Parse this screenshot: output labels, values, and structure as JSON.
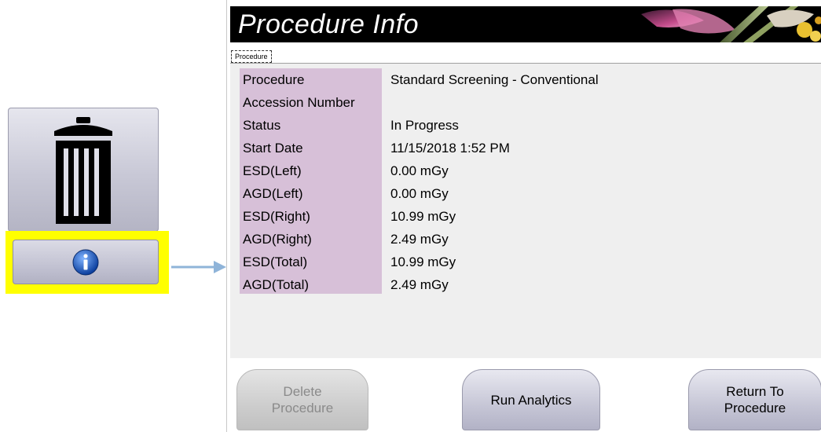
{
  "left_panel": {
    "trash_icon": "trash-can-icon",
    "info_icon": "info-icon",
    "highlight_color": "#ffff00"
  },
  "dialog": {
    "title": "Procedure Info",
    "tab_label": "Procedure",
    "rows": [
      {
        "label": "Procedure",
        "value": "Standard Screening - Conventional"
      },
      {
        "label": "Accession Number",
        "value": ""
      },
      {
        "label": "Status",
        "value": "In Progress"
      },
      {
        "label": "Start Date",
        "value": "11/15/2018 1:52 PM"
      },
      {
        "label": "ESD(Left)",
        "value": "0.00 mGy"
      },
      {
        "label": "AGD(Left)",
        "value": "0.00 mGy"
      },
      {
        "label": "ESD(Right)",
        "value": "10.99 mGy"
      },
      {
        "label": "AGD(Right)",
        "value": "2.49 mGy"
      },
      {
        "label": "ESD(Total)",
        "value": "10.99 mGy"
      },
      {
        "label": "AGD(Total)",
        "value": "2.49 mGy"
      }
    ],
    "buttons": {
      "delete_line1": "Delete",
      "delete_line2": "Procedure",
      "run_analytics": "Run Analytics",
      "return_line1": "Return To",
      "return_line2": "Procedure"
    }
  }
}
